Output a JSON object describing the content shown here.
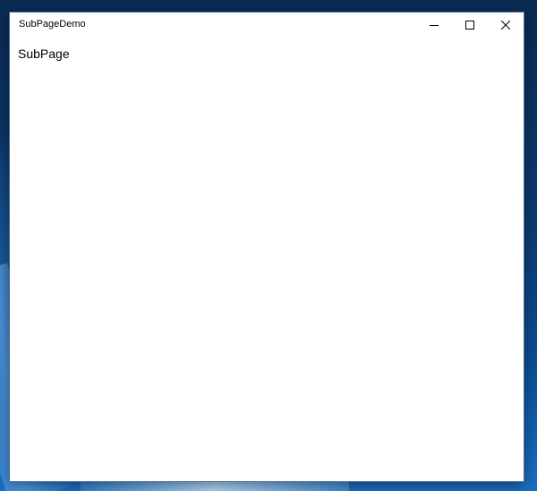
{
  "window": {
    "title": "SubPageDemo",
    "controls": {
      "minimize_icon": "minimize-icon",
      "maximize_icon": "maximize-icon",
      "close_icon": "close-icon"
    }
  },
  "content": {
    "text": "SubPage"
  },
  "colors": {
    "window_background": "#ffffff",
    "text": "#000000",
    "desktop_accent": "#0c3a70"
  }
}
